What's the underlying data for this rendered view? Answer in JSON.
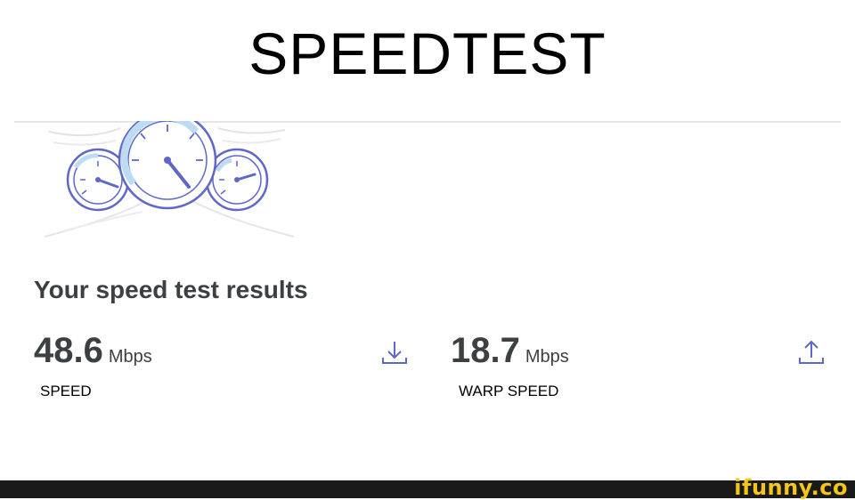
{
  "caption": "SPEEDTEST",
  "results": {
    "heading": "Your speed test results",
    "download": {
      "value": "48.6",
      "unit": "Mbps",
      "label": "SPEED",
      "icon": "download-icon"
    },
    "upload": {
      "value": "18.7",
      "unit": "Mbps",
      "label": "WARP SPEED",
      "icon": "upload-icon"
    }
  },
  "watermark": "ifunny.co",
  "colors": {
    "accent": "#5f67c9",
    "gauge_fill": "#bcdcf4",
    "text": "#3c4043"
  }
}
